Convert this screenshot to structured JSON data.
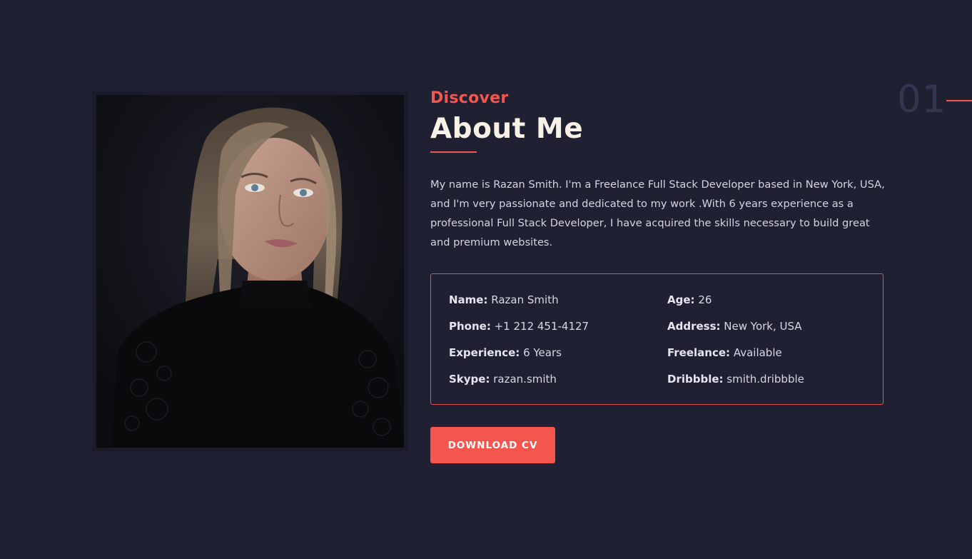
{
  "section": {
    "number": "01",
    "subtitle": "Discover",
    "title": "About Me"
  },
  "intro_text": "My name is Razan Smith. I'm a Freelance Full Stack Developer based in New York, USA, and I'm very passionate and dedicated to my work .With 6 years experience as a professional Full Stack Developer, I have acquired the skills necessary to build great and premium websites.",
  "info": {
    "name": {
      "label": "Name:",
      "value": "Razan Smith"
    },
    "age": {
      "label": "Age:",
      "value": "26"
    },
    "phone": {
      "label": "Phone:",
      "value": "+1 212 451-4127"
    },
    "address": {
      "label": "Address:",
      "value": "New York, USA"
    },
    "experience": {
      "label": "Experience:",
      "value": "6 Years"
    },
    "freelance": {
      "label": "Freelance:",
      "value": "Available"
    },
    "skype": {
      "label": "Skype:",
      "value": "razan.smith"
    },
    "dribbble": {
      "label": "Dribbble:",
      "value": "smith.dribbble"
    }
  },
  "cta": {
    "download_label": "DOWNLOAD CV"
  },
  "colors": {
    "background": "#1f2133",
    "accent": "#f4554d",
    "heading": "#f7f1e6",
    "muted_number": "#33364f"
  }
}
